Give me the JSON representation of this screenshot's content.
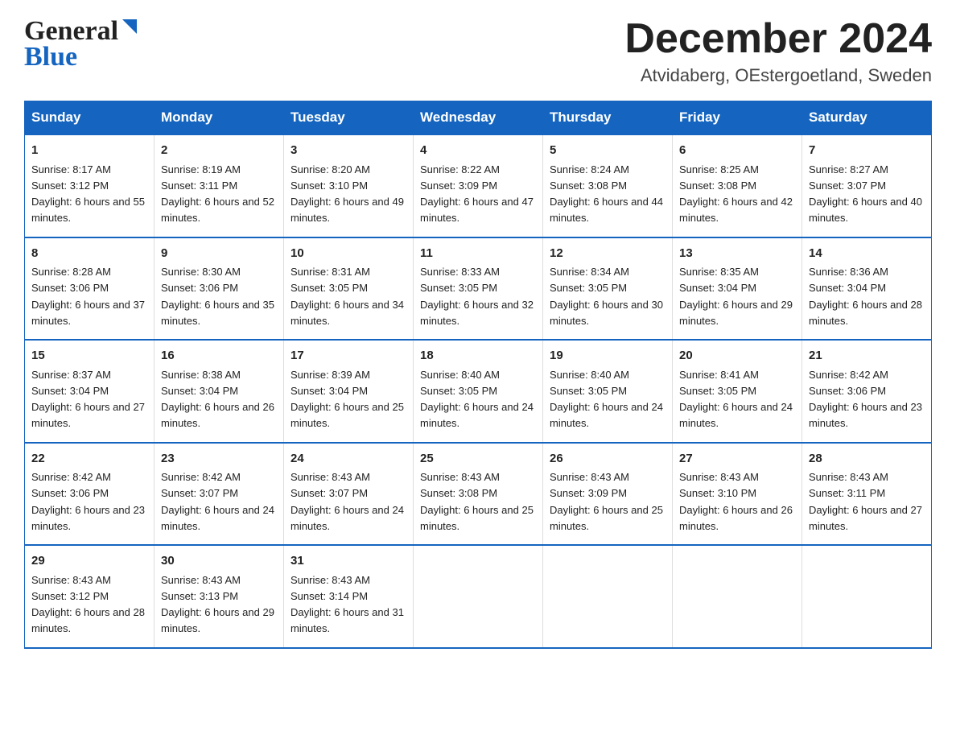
{
  "logo": {
    "part1": "General",
    "part2": "Blue"
  },
  "header": {
    "month_year": "December 2024",
    "location": "Atvidaberg, OEstergoetland, Sweden"
  },
  "columns": [
    "Sunday",
    "Monday",
    "Tuesday",
    "Wednesday",
    "Thursday",
    "Friday",
    "Saturday"
  ],
  "weeks": [
    [
      {
        "day": "1",
        "sunrise": "8:17 AM",
        "sunset": "3:12 PM",
        "daylight": "6 hours and 55 minutes."
      },
      {
        "day": "2",
        "sunrise": "8:19 AM",
        "sunset": "3:11 PM",
        "daylight": "6 hours and 52 minutes."
      },
      {
        "day": "3",
        "sunrise": "8:20 AM",
        "sunset": "3:10 PM",
        "daylight": "6 hours and 49 minutes."
      },
      {
        "day": "4",
        "sunrise": "8:22 AM",
        "sunset": "3:09 PM",
        "daylight": "6 hours and 47 minutes."
      },
      {
        "day": "5",
        "sunrise": "8:24 AM",
        "sunset": "3:08 PM",
        "daylight": "6 hours and 44 minutes."
      },
      {
        "day": "6",
        "sunrise": "8:25 AM",
        "sunset": "3:08 PM",
        "daylight": "6 hours and 42 minutes."
      },
      {
        "day": "7",
        "sunrise": "8:27 AM",
        "sunset": "3:07 PM",
        "daylight": "6 hours and 40 minutes."
      }
    ],
    [
      {
        "day": "8",
        "sunrise": "8:28 AM",
        "sunset": "3:06 PM",
        "daylight": "6 hours and 37 minutes."
      },
      {
        "day": "9",
        "sunrise": "8:30 AM",
        "sunset": "3:06 PM",
        "daylight": "6 hours and 35 minutes."
      },
      {
        "day": "10",
        "sunrise": "8:31 AM",
        "sunset": "3:05 PM",
        "daylight": "6 hours and 34 minutes."
      },
      {
        "day": "11",
        "sunrise": "8:33 AM",
        "sunset": "3:05 PM",
        "daylight": "6 hours and 32 minutes."
      },
      {
        "day": "12",
        "sunrise": "8:34 AM",
        "sunset": "3:05 PM",
        "daylight": "6 hours and 30 minutes."
      },
      {
        "day": "13",
        "sunrise": "8:35 AM",
        "sunset": "3:04 PM",
        "daylight": "6 hours and 29 minutes."
      },
      {
        "day": "14",
        "sunrise": "8:36 AM",
        "sunset": "3:04 PM",
        "daylight": "6 hours and 28 minutes."
      }
    ],
    [
      {
        "day": "15",
        "sunrise": "8:37 AM",
        "sunset": "3:04 PM",
        "daylight": "6 hours and 27 minutes."
      },
      {
        "day": "16",
        "sunrise": "8:38 AM",
        "sunset": "3:04 PM",
        "daylight": "6 hours and 26 minutes."
      },
      {
        "day": "17",
        "sunrise": "8:39 AM",
        "sunset": "3:04 PM",
        "daylight": "6 hours and 25 minutes."
      },
      {
        "day": "18",
        "sunrise": "8:40 AM",
        "sunset": "3:05 PM",
        "daylight": "6 hours and 24 minutes."
      },
      {
        "day": "19",
        "sunrise": "8:40 AM",
        "sunset": "3:05 PM",
        "daylight": "6 hours and 24 minutes."
      },
      {
        "day": "20",
        "sunrise": "8:41 AM",
        "sunset": "3:05 PM",
        "daylight": "6 hours and 24 minutes."
      },
      {
        "day": "21",
        "sunrise": "8:42 AM",
        "sunset": "3:06 PM",
        "daylight": "6 hours and 23 minutes."
      }
    ],
    [
      {
        "day": "22",
        "sunrise": "8:42 AM",
        "sunset": "3:06 PM",
        "daylight": "6 hours and 23 minutes."
      },
      {
        "day": "23",
        "sunrise": "8:42 AM",
        "sunset": "3:07 PM",
        "daylight": "6 hours and 24 minutes."
      },
      {
        "day": "24",
        "sunrise": "8:43 AM",
        "sunset": "3:07 PM",
        "daylight": "6 hours and 24 minutes."
      },
      {
        "day": "25",
        "sunrise": "8:43 AM",
        "sunset": "3:08 PM",
        "daylight": "6 hours and 25 minutes."
      },
      {
        "day": "26",
        "sunrise": "8:43 AM",
        "sunset": "3:09 PM",
        "daylight": "6 hours and 25 minutes."
      },
      {
        "day": "27",
        "sunrise": "8:43 AM",
        "sunset": "3:10 PM",
        "daylight": "6 hours and 26 minutes."
      },
      {
        "day": "28",
        "sunrise": "8:43 AM",
        "sunset": "3:11 PM",
        "daylight": "6 hours and 27 minutes."
      }
    ],
    [
      {
        "day": "29",
        "sunrise": "8:43 AM",
        "sunset": "3:12 PM",
        "daylight": "6 hours and 28 minutes."
      },
      {
        "day": "30",
        "sunrise": "8:43 AM",
        "sunset": "3:13 PM",
        "daylight": "6 hours and 29 minutes."
      },
      {
        "day": "31",
        "sunrise": "8:43 AM",
        "sunset": "3:14 PM",
        "daylight": "6 hours and 31 minutes."
      },
      {
        "day": "",
        "sunrise": "",
        "sunset": "",
        "daylight": ""
      },
      {
        "day": "",
        "sunrise": "",
        "sunset": "",
        "daylight": ""
      },
      {
        "day": "",
        "sunrise": "",
        "sunset": "",
        "daylight": ""
      },
      {
        "day": "",
        "sunrise": "",
        "sunset": "",
        "daylight": ""
      }
    ]
  ]
}
